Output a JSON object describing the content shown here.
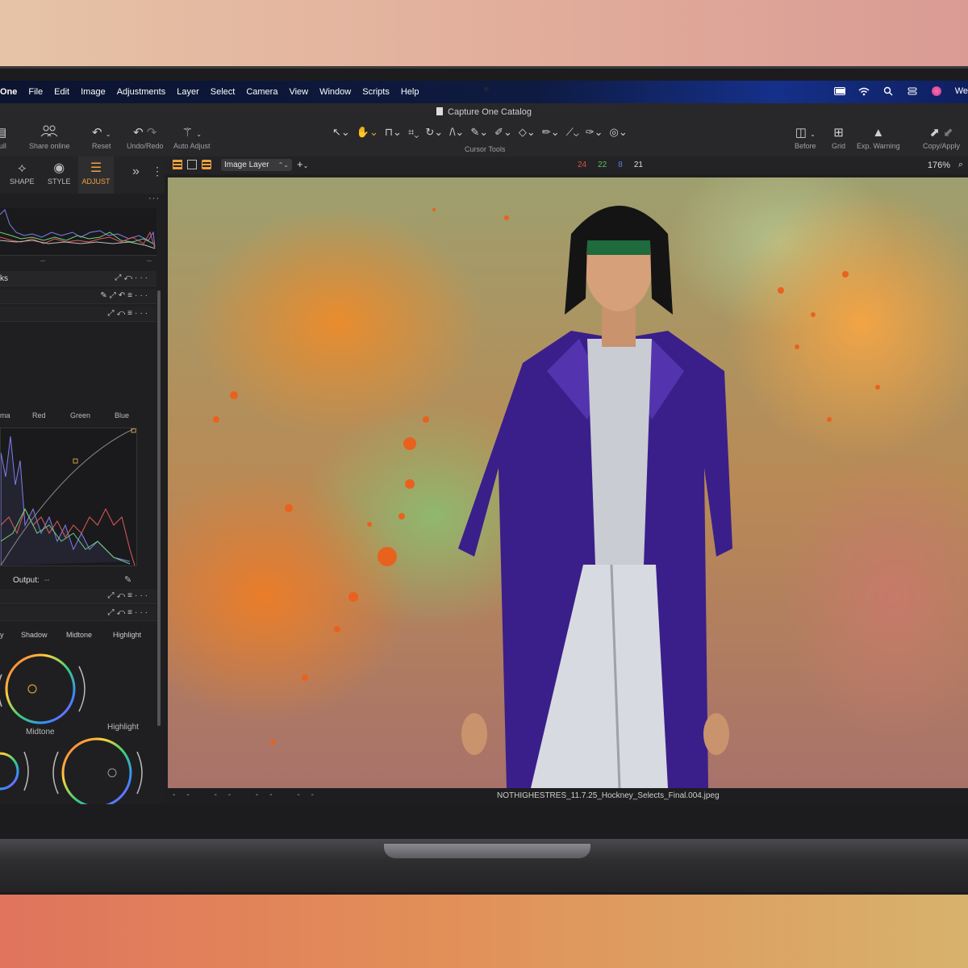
{
  "menubar": {
    "items": [
      "One",
      "File",
      "Edit",
      "Image",
      "Adjustments",
      "Layer",
      "Select",
      "Camera",
      "View",
      "Window",
      "Scripts",
      "Help"
    ],
    "right_text": "We"
  },
  "window": {
    "title": "Capture One Catalog"
  },
  "toolbar": {
    "cull": "Cull",
    "share_online": "Share online",
    "reset": "Reset",
    "undo_redo": "Undo/Redo",
    "auto_adjust": "Auto Adjust",
    "cursor_tools": "Cursor Tools",
    "before": "Before",
    "grid": "Grid",
    "exp_warning": "Exp. Warning",
    "copy_apply": "Copy/Apply"
  },
  "tool_tabs": {
    "shape": "SHAPE",
    "style": "STYLE",
    "adjust": "ADJUST"
  },
  "viewer_header": {
    "layer": "Image Layer",
    "counts": [
      {
        "value": "24",
        "color": "#e0503f"
      },
      {
        "value": "22",
        "color": "#57c15a"
      },
      {
        "value": "8",
        "color": "#5b7fe0"
      },
      {
        "value": "21",
        "color": "#dddddd"
      }
    ],
    "zoom": "176%"
  },
  "left_panel": {
    "histogram_ticks": [
      "--",
      "--"
    ],
    "levels_title": "ks",
    "curve_channels": [
      "ma",
      "Red",
      "Green",
      "Blue"
    ],
    "output_label": "Output:",
    "output_value": "--",
    "wheel_tabs": [
      "y",
      "Shadow",
      "Midtone",
      "Highlight"
    ],
    "wheel_labels": {
      "midtone": "Midtone",
      "highlight": "Highlight"
    }
  },
  "viewer": {
    "filename": "NOTHIGHESTRES_11.7.25_Hockney_Selects_Final.004.jpeg",
    "footer_dashes": "-- -- -- --"
  }
}
